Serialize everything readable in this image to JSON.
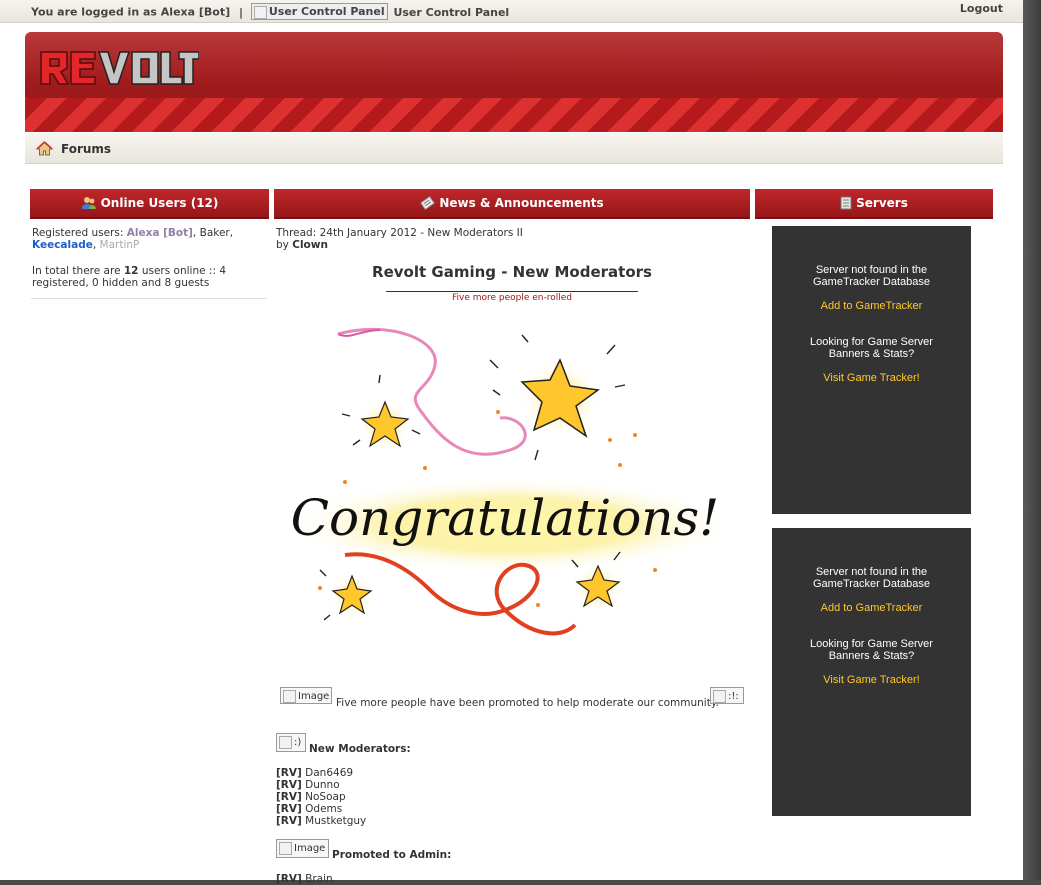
{
  "topbar": {
    "logged_in_text": "You are logged in as Alexa [Bot]",
    "separator": "|",
    "ucp_image_alt": "User Control Panel",
    "ucp_link": "User Control Panel",
    "logout": "Logout"
  },
  "header": {
    "logo_text": "REVOLT"
  },
  "breadcrumb": {
    "label": "Forums"
  },
  "online_users": {
    "title": "Online Users (12)",
    "registered_label": "Registered users:",
    "users": [
      "Alexa [Bot]",
      "Baker",
      "Keecalade",
      "MartinP"
    ],
    "total_prefix": "In total there are ",
    "total_count": "12",
    "total_suffix": " users online :: 4 registered, 0 hidden and 8 guests"
  },
  "news": {
    "title": "News & Announcements",
    "thread": "Thread: 24th January 2012 - New Moderators II",
    "by_label": "by",
    "author": "Clown",
    "headline": "Revolt Gaming - New Moderators",
    "subheadline": "Five more people en-rolled",
    "congrats_text": "Congratulations!",
    "image_alt": "Image",
    "promo_text": "Five more people have been promoted to help moderate our community.",
    "smiley_1_alt": ":!:",
    "smiley_2_alt": ":)",
    "new_mods_label": "New Moderators:",
    "tag": "[RV]",
    "moderators": [
      "Dan6469",
      "Dunno",
      "NoSoap",
      "Odems",
      "Mustketguy"
    ],
    "admin_image_alt": "Image",
    "promoted_admin_label": "Promoted to Admin:",
    "admins": [
      "Brain"
    ]
  },
  "servers": {
    "title": "Servers",
    "boxes": [
      {
        "not_found": "Server not found in the GameTracker Database",
        "add_link": "Add to GameTracker",
        "looking": "Looking for Game Server Banners & Stats?",
        "visit_link": "Visit Game Tracker!"
      },
      {
        "not_found": "Server not found in the GameTracker Database",
        "add_link": "Add to GameTracker",
        "looking": "Looking for Game Server Banners & Stats?",
        "visit_link": "Visit Game Tracker!"
      }
    ]
  },
  "colors": {
    "header_red": "#a51d20",
    "link_blue": "#1a5ec7",
    "bot_purple": "#8f7fa8",
    "server_bg": "#333333",
    "server_link": "#ffc82b",
    "subheadline_red": "#a01818"
  }
}
